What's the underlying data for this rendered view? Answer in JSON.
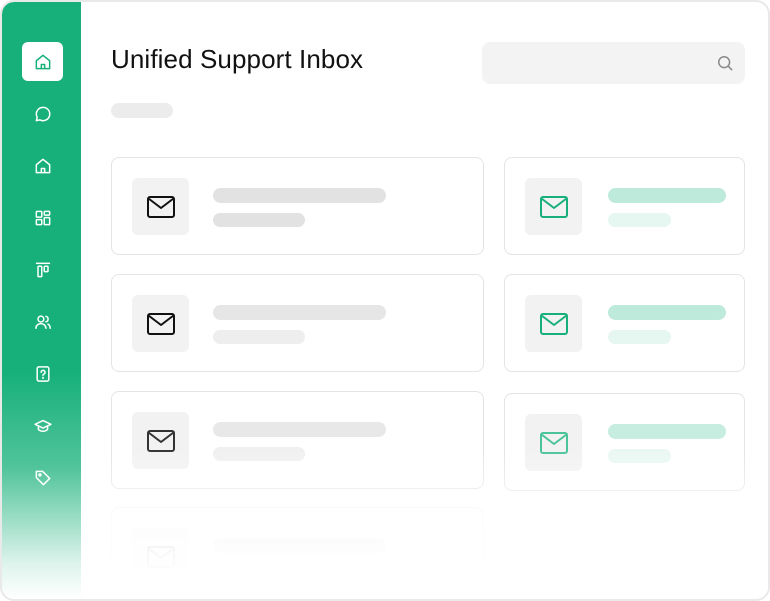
{
  "header": {
    "title": "Unified Support Inbox",
    "search_placeholder": ""
  },
  "sidebar": {
    "items": [
      {
        "icon": "home-icon",
        "active": true
      },
      {
        "icon": "chat-icon",
        "active": false
      },
      {
        "icon": "home-icon",
        "active": false
      },
      {
        "icon": "grid-icon",
        "active": false
      },
      {
        "icon": "align-top-icon",
        "active": false
      },
      {
        "icon": "users-icon",
        "active": false
      },
      {
        "icon": "help-icon",
        "active": false
      },
      {
        "icon": "graduation-cap-icon",
        "active": false
      },
      {
        "icon": "tag-icon",
        "active": false
      }
    ]
  },
  "colors": {
    "brand": "#17b07a",
    "skeleton_grey": "#e4e4e4",
    "skeleton_green": "#bdeadb"
  },
  "messages": {
    "left_column_icon": "mail-icon",
    "right_column_icon": "mail-icon"
  }
}
